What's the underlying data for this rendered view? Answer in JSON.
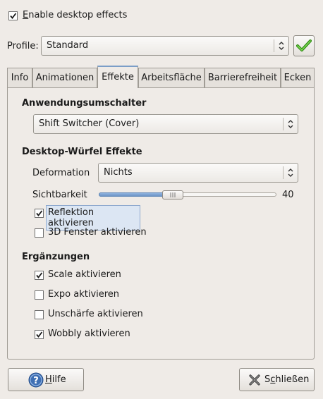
{
  "enable_effects": {
    "label_pre": "",
    "label_mn": "E",
    "label_post": "nable desktop effects",
    "checked": true
  },
  "profile": {
    "label": "Profile:",
    "value": "Standard"
  },
  "tabs": [
    "Info",
    "Animationen",
    "Effekte",
    "Arbeitsfläche",
    "Barrierefreiheit",
    "Ecken"
  ],
  "active_tab": "Effekte",
  "section_switcher": {
    "title": "Anwendungsumschalter",
    "value": "Shift Switcher (Cover)"
  },
  "section_cube": {
    "title": "Desktop-Würfel Effekte",
    "deformation_label": "Deformation",
    "deformation_value": "Nichts",
    "visibility_label": "Sichtbarkeit",
    "visibility_value": "40",
    "reflection_label": "Reflektion aktivieren",
    "reflection_checked": true,
    "windows3d_label": "3D Fenster aktivieren",
    "windows3d_checked": false
  },
  "section_extras": {
    "title": "Ergänzungen",
    "items": [
      {
        "label": "Scale aktivieren",
        "checked": true
      },
      {
        "label": "Expo aktivieren",
        "checked": false
      },
      {
        "label": "Unschärfe aktivieren",
        "checked": false
      },
      {
        "label": "Wobbly aktivieren",
        "checked": true
      }
    ]
  },
  "buttons": {
    "help_pre": "",
    "help_mn": "H",
    "help_post": "ilfe",
    "close_pre": "S",
    "close_mn": "c",
    "close_post": "hließen"
  }
}
